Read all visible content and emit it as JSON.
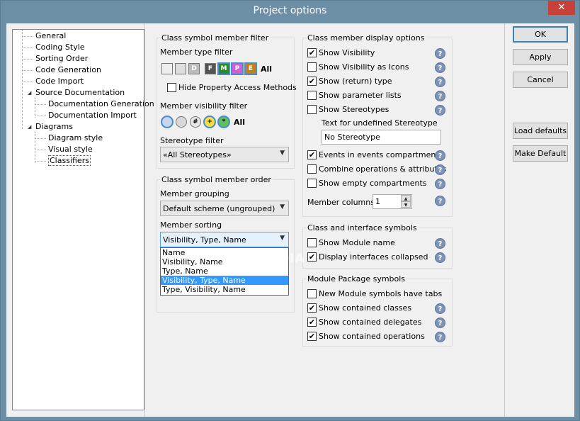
{
  "window": {
    "title": "Project options",
    "close_glyph": "✕"
  },
  "tree": {
    "items": [
      {
        "label": "General"
      },
      {
        "label": "Coding Style"
      },
      {
        "label": "Sorting Order"
      },
      {
        "label": "Code Generation"
      },
      {
        "label": "Code Import"
      },
      {
        "label": "Source Documentation"
      },
      {
        "label": "Documentation Generation"
      },
      {
        "label": "Documentation Import"
      },
      {
        "label": "Diagrams"
      },
      {
        "label": "Diagram style"
      },
      {
        "label": "Visual style"
      },
      {
        "label": "Classifiers"
      }
    ]
  },
  "filter": {
    "title": "Class symbol member filter",
    "member_type_label": "Member type filter",
    "type_icons": [
      "",
      "",
      "D",
      "F",
      "M",
      "P",
      "E"
    ],
    "all_label": "All",
    "hide_property_label": "Hide Property Access Methods",
    "visibility_label": "Member visibility filter",
    "visibility_icons": [
      "",
      "",
      "#",
      "+",
      "*"
    ],
    "visibility_all_label": "All",
    "stereotype_label": "Stereotype filter",
    "stereotype_value": "«All Stereotypes»"
  },
  "order": {
    "title": "Class symbol member order",
    "grouping_label": "Member grouping",
    "grouping_value": "Default scheme (ungrouped)",
    "sorting_label": "Member sorting",
    "sorting_value": "Visibility, Type, Name",
    "sorting_options": [
      {
        "label": "Name",
        "selected": false
      },
      {
        "label": "Visibility, Name",
        "selected": false
      },
      {
        "label": "Type, Name",
        "selected": false
      },
      {
        "label": "Visibility, Type, Name",
        "selected": true
      },
      {
        "label": "Type, Visibility, Name",
        "selected": false
      }
    ]
  },
  "display": {
    "title": "Class member display options",
    "show_visibility": {
      "label": "Show Visibility",
      "checked": true
    },
    "show_visibility_icons": {
      "label": "Show Visibility as Icons",
      "checked": false
    },
    "show_return_type": {
      "label": "Show (return) type",
      "checked": true
    },
    "show_param_lists": {
      "label": "Show parameter lists",
      "checked": false
    },
    "show_stereotypes": {
      "label": "Show Stereotypes",
      "checked": false
    },
    "undefined_stereotype_label": "Text for undefined Stereotype",
    "undefined_stereotype_value": "No Stereotype",
    "events_compartment": {
      "label": "Events in events compartment",
      "checked": true
    },
    "combine_ops": {
      "label": "Combine operations & attributes",
      "checked": false
    },
    "show_empty": {
      "label": "Show empty compartments",
      "checked": false
    },
    "member_columns_label": "Member columns",
    "member_columns_value": "1"
  },
  "interface": {
    "title": "Class and interface symbols",
    "show_module_name": {
      "label": "Show Module name",
      "checked": false
    },
    "display_collapsed": {
      "label": "Display interfaces collapsed",
      "checked": true
    }
  },
  "module": {
    "title": "Module Package symbols",
    "new_module_tabs": {
      "label": "New Module symbols have tabs",
      "checked": false
    },
    "show_classes": {
      "label": "Show contained classes",
      "checked": true
    },
    "show_delegates": {
      "label": "Show contained delegates",
      "checked": true
    },
    "show_operations": {
      "label": "Show contained operations",
      "checked": true
    }
  },
  "buttons": {
    "ok": "OK",
    "apply": "Apply",
    "cancel": "Cancel",
    "load_defaults": "Load defaults",
    "make_default": "Make Default"
  },
  "help_glyph": "?",
  "check_glyph": "✔",
  "arrow_glyph": "▼",
  "spin_up_glyph": "▲",
  "spin_down_glyph": "▼",
  "watermark": "SOFTPEDIA",
  "colors": {
    "title_bar": "#6c8fa6",
    "close": "#c7403a",
    "selection": "#3399ff"
  }
}
